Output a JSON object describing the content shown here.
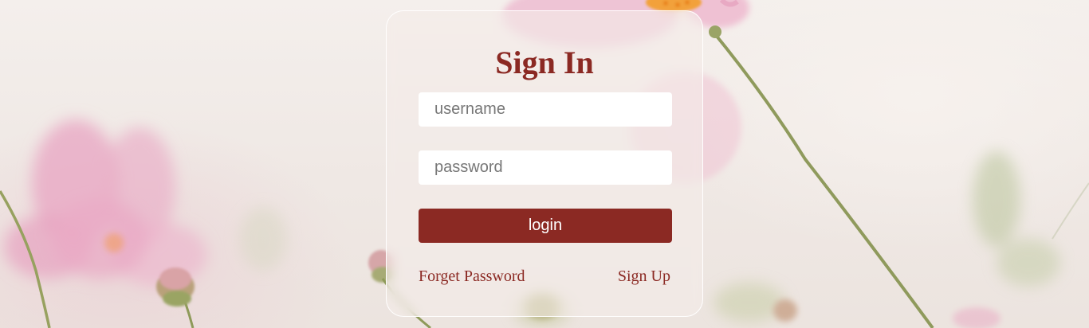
{
  "login_form": {
    "title": "Sign In",
    "username_placeholder": "username",
    "password_placeholder": "password",
    "login_label": "login",
    "forget_password_label": "Forget Password",
    "sign_up_label": "Sign Up"
  },
  "colors": {
    "accent": "#8b2923",
    "input_background": "#ffffff",
    "button_text": "#ffffff"
  },
  "background": {
    "icon": "pink-cosmos-flowers-photo"
  }
}
